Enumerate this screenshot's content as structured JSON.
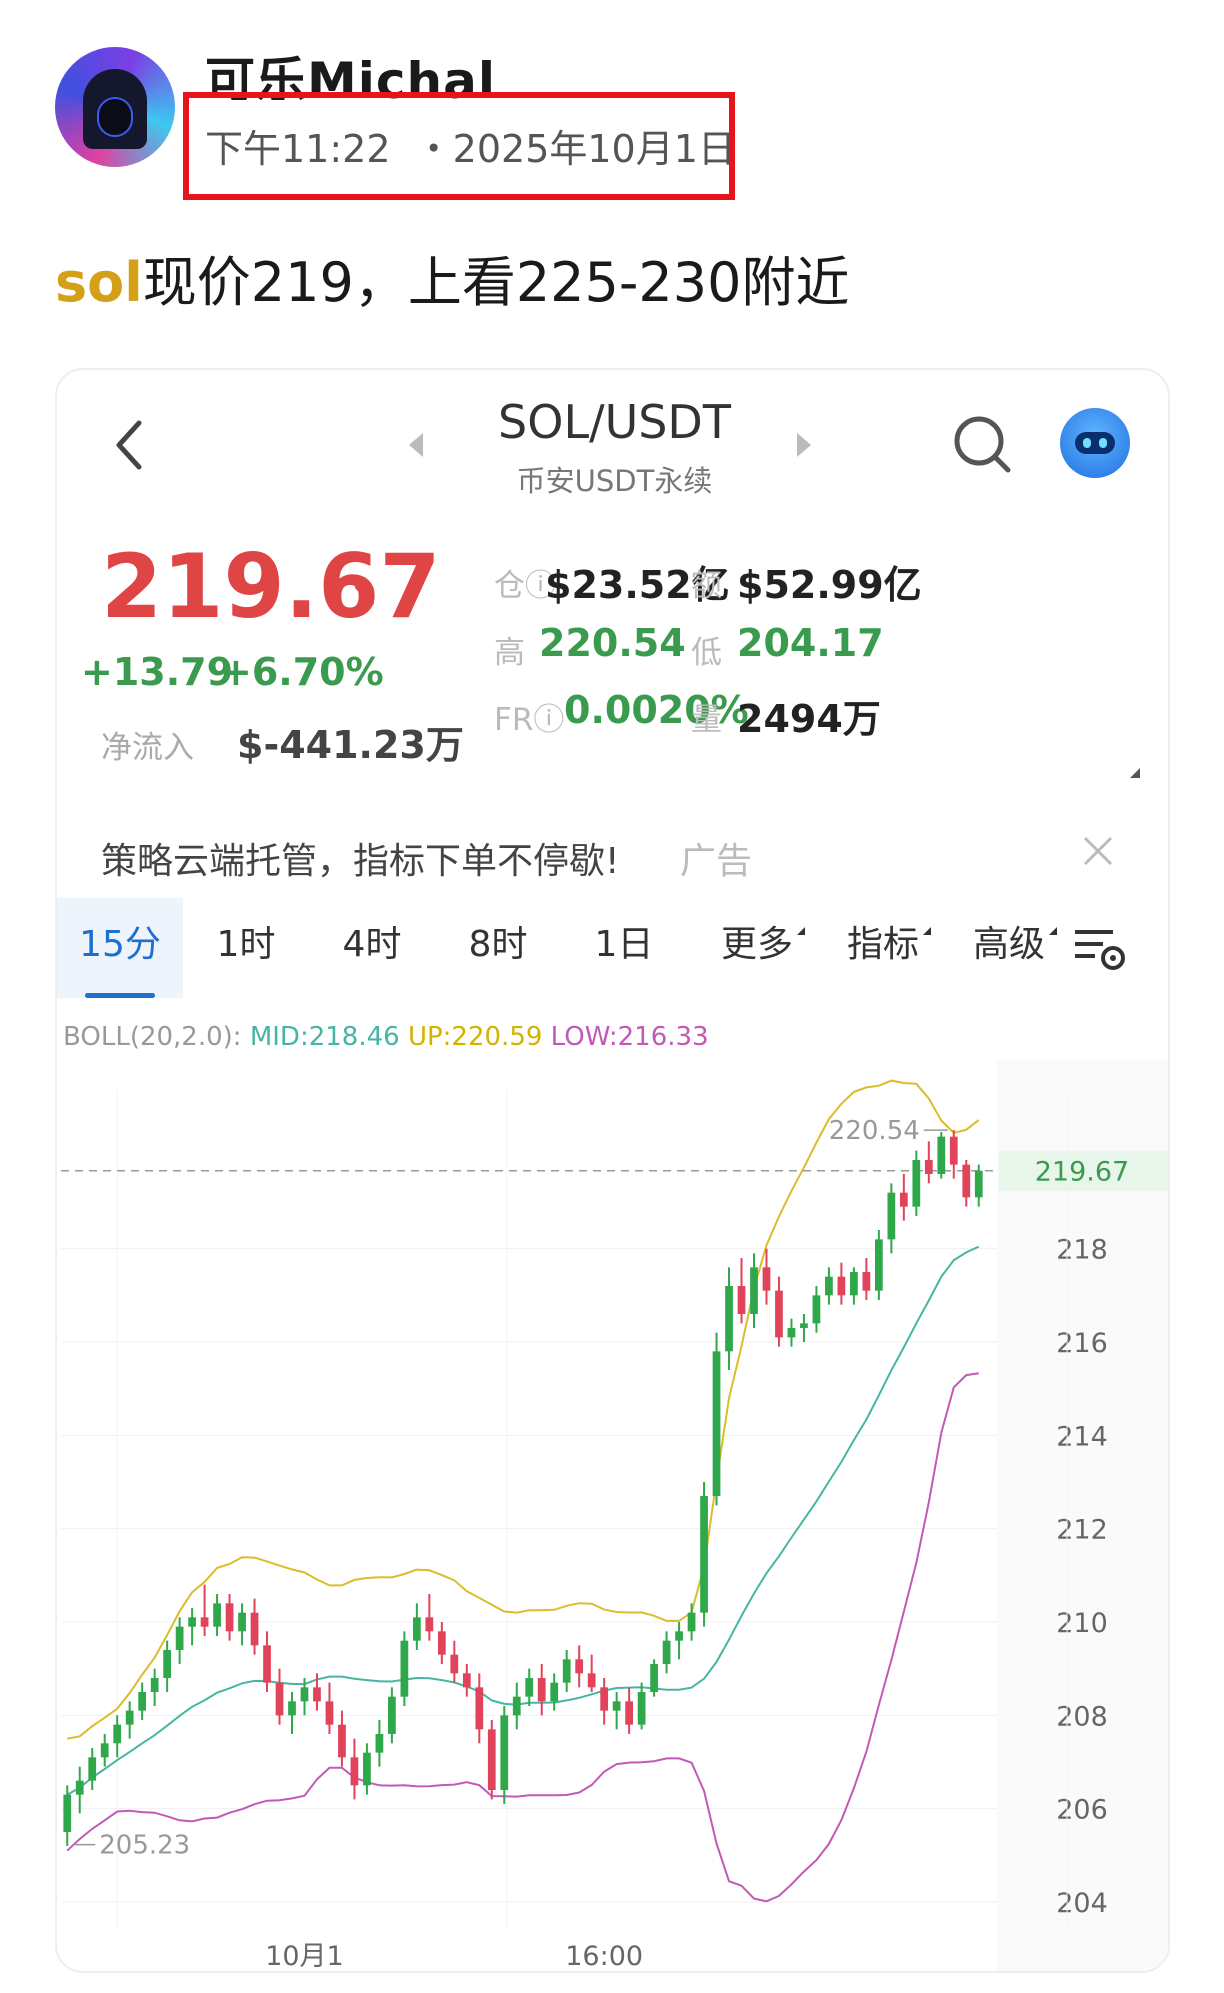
{
  "post": {
    "username": "可乐Michal",
    "timestamp": "下午11:22  ・2025年10月1日",
    "text_tag": "sol",
    "text_body": "现价219，上看225-230附近"
  },
  "header": {
    "pair": "SOL/USDT",
    "subtitle": "币安USDT永续"
  },
  "ticker": {
    "price": "219.67",
    "price_arrow": "↘",
    "change_abs": "+13.79",
    "change_pct": "+6.70%",
    "netflow_label": "净流入",
    "netflow": "$-441.23万",
    "stats": [
      {
        "label": "仓ⓘ",
        "value": "$23.52亿",
        "color": "dark"
      },
      {
        "label": "额",
        "value": "$52.99亿",
        "color": "dark"
      },
      {
        "label": "高",
        "value": "220.54",
        "color": "green"
      },
      {
        "label": "低",
        "value": "204.17",
        "color": "green"
      },
      {
        "label": "FRⓘ",
        "value": "0.0020%",
        "color": "green"
      },
      {
        "label": "量",
        "value": "2494万",
        "color": "dark"
      }
    ]
  },
  "ad": {
    "text": "策略云端托管，指标下单不停歇!",
    "tag": "广告"
  },
  "tabs": [
    {
      "label": "15分",
      "active": true
    },
    {
      "label": "1时"
    },
    {
      "label": "4时"
    },
    {
      "label": "8时"
    },
    {
      "label": "1日"
    },
    {
      "label": "更多",
      "caret": true
    },
    {
      "label": "指标",
      "caret": true
    },
    {
      "label": "高级",
      "caret": true
    }
  ],
  "indicator": {
    "name": "BOLL(20,2.0):",
    "mid": "MID:218.46",
    "up": "UP:220.59",
    "low": "LOW:216.33"
  },
  "chart_data": {
    "type": "candlestick",
    "y_ticks": [
      "218",
      "216",
      "214",
      "212",
      "210",
      "208",
      "206",
      "204"
    ],
    "ylim": [
      203.4,
      221.4
    ],
    "x_ticks": [
      "10月1",
      "16:00"
    ],
    "current_price_label": "219.67",
    "current_price": 219.67,
    "high_annotation": "220.54",
    "high": 220.54,
    "low_annotation": "205.23",
    "low": 205.23,
    "colors": {
      "up": "#2ea84a",
      "down": "#e0435a",
      "mid": "#47b5a3",
      "upper": "#d9bd2a",
      "lower": "#c259b5"
    },
    "candles": [
      [
        205.5,
        206.5,
        205.2,
        206.3
      ],
      [
        206.3,
        206.9,
        205.9,
        206.6
      ],
      [
        206.6,
        207.3,
        206.4,
        207.1
      ],
      [
        207.1,
        207.6,
        206.9,
        207.4
      ],
      [
        207.4,
        208.0,
        207.1,
        207.8
      ],
      [
        207.8,
        208.3,
        207.5,
        208.1
      ],
      [
        208.1,
        208.7,
        207.9,
        208.5
      ],
      [
        208.5,
        209.0,
        208.2,
        208.8
      ],
      [
        208.8,
        209.6,
        208.5,
        209.4
      ],
      [
        209.4,
        210.1,
        209.1,
        209.9
      ],
      [
        209.9,
        210.3,
        209.5,
        210.1
      ],
      [
        210.1,
        210.8,
        209.7,
        209.9
      ],
      [
        209.9,
        210.6,
        209.7,
        210.4
      ],
      [
        210.4,
        210.6,
        209.6,
        209.8
      ],
      [
        209.8,
        210.4,
        209.5,
        210.2
      ],
      [
        210.2,
        210.5,
        209.3,
        209.5
      ],
      [
        209.5,
        209.8,
        208.5,
        208.7
      ],
      [
        208.7,
        209.0,
        207.8,
        208.0
      ],
      [
        208.0,
        208.5,
        207.6,
        208.3
      ],
      [
        208.3,
        208.8,
        208.0,
        208.6
      ],
      [
        208.6,
        208.9,
        208.1,
        208.3
      ],
      [
        208.3,
        208.7,
        207.6,
        207.8
      ],
      [
        207.8,
        208.1,
        206.9,
        207.1
      ],
      [
        207.1,
        207.5,
        206.2,
        206.5
      ],
      [
        206.5,
        207.4,
        206.3,
        207.2
      ],
      [
        207.2,
        207.9,
        206.9,
        207.6
      ],
      [
        207.6,
        208.6,
        207.4,
        208.4
      ],
      [
        208.4,
        209.8,
        208.2,
        209.6
      ],
      [
        209.6,
        210.4,
        209.4,
        210.1
      ],
      [
        210.1,
        210.6,
        209.6,
        209.8
      ],
      [
        209.8,
        210.0,
        209.1,
        209.3
      ],
      [
        209.3,
        209.6,
        208.7,
        208.9
      ],
      [
        208.9,
        209.1,
        208.4,
        208.6
      ],
      [
        208.6,
        208.9,
        207.4,
        207.7
      ],
      [
        207.7,
        207.9,
        206.2,
        206.4
      ],
      [
        206.4,
        208.2,
        206.1,
        208.0
      ],
      [
        208.0,
        208.7,
        207.7,
        208.4
      ],
      [
        208.4,
        209.0,
        208.2,
        208.8
      ],
      [
        208.8,
        209.1,
        208.0,
        208.3
      ],
      [
        208.3,
        208.9,
        208.1,
        208.7
      ],
      [
        208.7,
        209.4,
        208.5,
        209.2
      ],
      [
        209.2,
        209.5,
        208.6,
        208.9
      ],
      [
        208.9,
        209.3,
        208.5,
        208.6
      ],
      [
        208.6,
        208.8,
        207.8,
        208.1
      ],
      [
        208.1,
        208.5,
        207.7,
        208.3
      ],
      [
        208.3,
        208.6,
        207.6,
        207.8
      ],
      [
        207.8,
        208.7,
        207.7,
        208.5
      ],
      [
        208.5,
        209.2,
        208.4,
        209.1
      ],
      [
        209.1,
        209.8,
        208.9,
        209.6
      ],
      [
        209.6,
        210.0,
        209.2,
        209.8
      ],
      [
        209.8,
        210.4,
        209.6,
        210.2
      ],
      [
        210.2,
        213.0,
        209.9,
        212.7
      ],
      [
        212.7,
        216.2,
        212.5,
        215.8
      ],
      [
        215.8,
        217.6,
        215.4,
        217.2
      ],
      [
        217.2,
        217.8,
        216.4,
        216.6
      ],
      [
        216.6,
        217.9,
        216.3,
        217.6
      ],
      [
        217.6,
        218.0,
        216.8,
        217.1
      ],
      [
        217.1,
        217.4,
        215.9,
        216.1
      ],
      [
        216.1,
        216.5,
        215.9,
        216.3
      ],
      [
        216.3,
        216.6,
        216.0,
        216.4
      ],
      [
        216.4,
        217.2,
        216.2,
        217.0
      ],
      [
        217.0,
        217.6,
        216.8,
        217.4
      ],
      [
        217.4,
        217.7,
        216.8,
        217.0
      ],
      [
        217.0,
        217.6,
        216.8,
        217.5
      ],
      [
        217.5,
        217.8,
        216.9,
        217.1
      ],
      [
        217.1,
        218.4,
        216.9,
        218.2
      ],
      [
        218.2,
        219.4,
        217.9,
        219.2
      ],
      [
        219.2,
        219.6,
        218.6,
        218.9
      ],
      [
        218.9,
        220.1,
        218.7,
        219.9
      ],
      [
        219.9,
        220.3,
        219.4,
        219.6
      ],
      [
        219.6,
        220.5,
        219.5,
        220.4
      ],
      [
        220.4,
        220.54,
        219.5,
        219.8
      ],
      [
        219.8,
        219.9,
        218.9,
        219.1
      ],
      [
        219.1,
        219.8,
        218.9,
        219.67
      ]
    ]
  }
}
